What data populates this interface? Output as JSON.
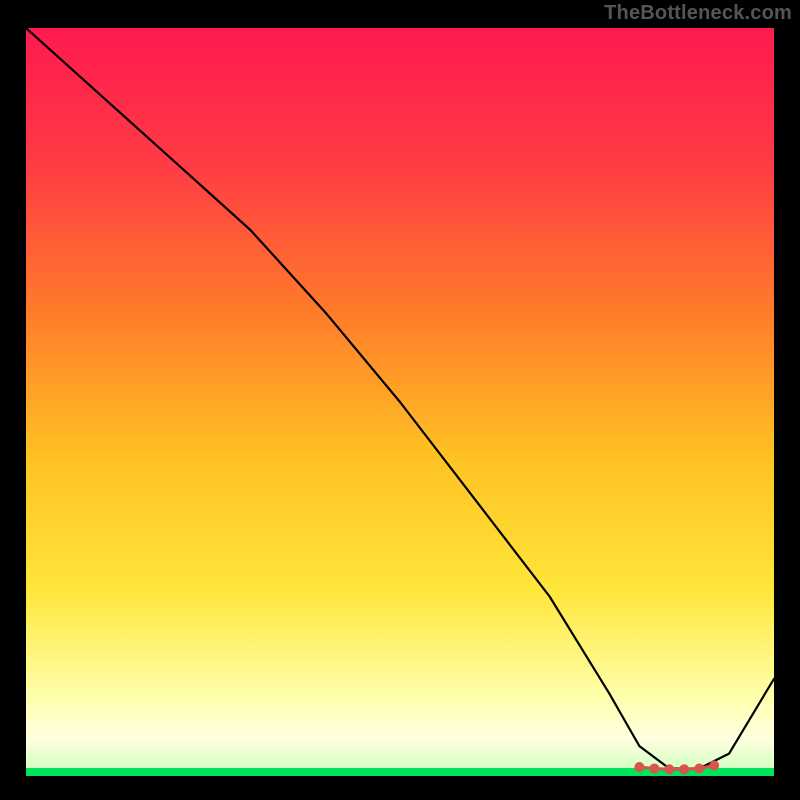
{
  "attribution": "TheBottleneck.com",
  "colors": {
    "page_bg": "#000000",
    "gradient_top": "#ff1a4f",
    "gradient_mid1": "#ff7a2a",
    "gradient_mid2": "#ffe63a",
    "gradient_low": "#ffffa8",
    "gradient_base": "#00e35a",
    "curve": "#000000",
    "marker": "#d9534f"
  },
  "chart_data": {
    "type": "line",
    "title": "",
    "xlabel": "",
    "ylabel": "",
    "xlim": [
      0,
      100
    ],
    "ylim": [
      0,
      100
    ],
    "series": [
      {
        "name": "main-curve",
        "x": [
          0,
          10,
          20,
          30,
          40,
          50,
          60,
          70,
          78,
          82,
          86,
          90,
          94,
          100
        ],
        "y": [
          100,
          91,
          82,
          73,
          62,
          50,
          37,
          24,
          11,
          4,
          1,
          1,
          3,
          13
        ]
      }
    ],
    "markers": {
      "name": "optimal-range",
      "x": [
        82,
        84,
        86,
        88,
        90,
        92
      ],
      "y": [
        1.2,
        1.0,
        0.9,
        0.9,
        1.0,
        1.4
      ]
    }
  }
}
